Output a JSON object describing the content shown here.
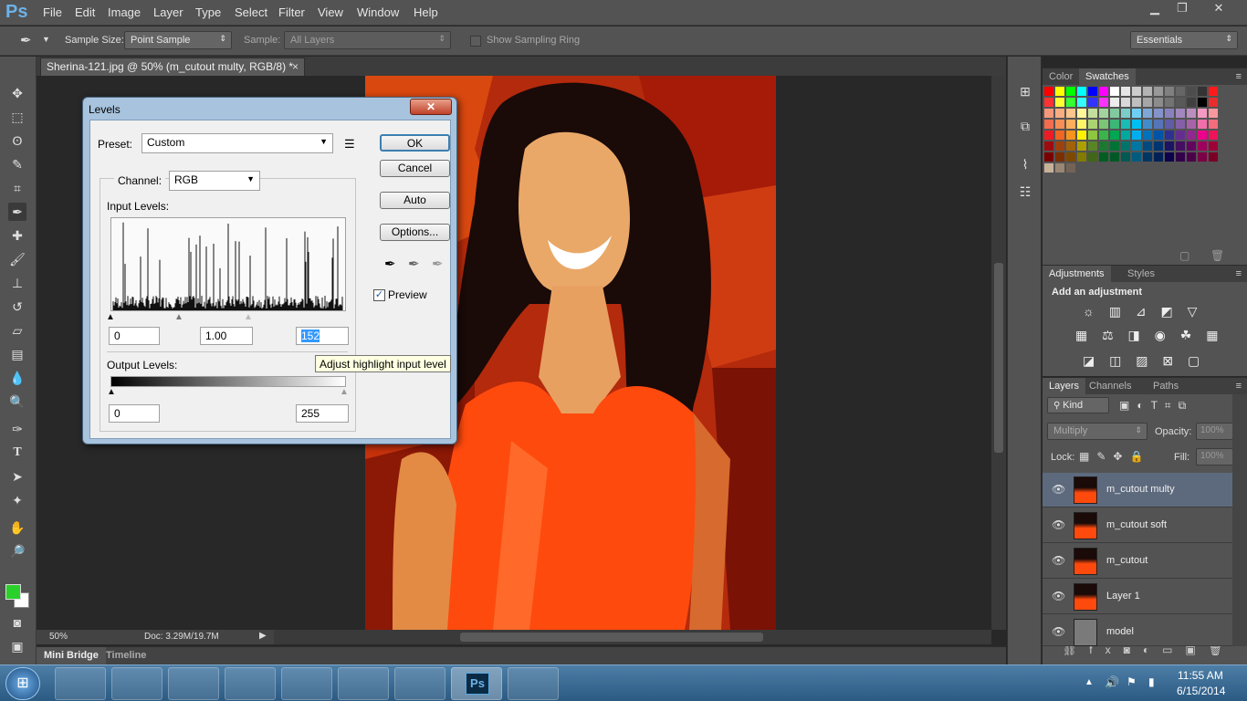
{
  "app": {
    "logo": "Ps",
    "menu": [
      "File",
      "Edit",
      "Image",
      "Layer",
      "Type",
      "Select",
      "Filter",
      "View",
      "Window",
      "Help"
    ]
  },
  "options_bar": {
    "sample_size_label": "Sample Size:",
    "sample_size_value": "Point Sample",
    "sample_label": "Sample:",
    "sample_value": "All Layers",
    "show_ring_label": "Show Sampling Ring",
    "workspace": "Essentials"
  },
  "document_tab": {
    "title": "Sherina-121.jpg @ 50% (m_cutout multy, RGB/8) *",
    "close": "×"
  },
  "status": {
    "zoom": "50%",
    "doc": "Doc: 3.29M/19.7M"
  },
  "bottom_tabs": [
    "Mini Bridge",
    "Timeline"
  ],
  "levels_dialog": {
    "title": "Levels",
    "preset_label": "Preset:",
    "preset_value": "Custom",
    "channel_label": "Channel:",
    "channel_value": "RGB",
    "input_levels_label": "Input Levels:",
    "input_black": "0",
    "input_gamma": "1.00",
    "input_white": "152",
    "output_levels_label": "Output Levels:",
    "output_black": "0",
    "output_white": "255",
    "buttons": [
      "OK",
      "Cancel",
      "Auto",
      "Options..."
    ],
    "preview_label": "Preview",
    "preview_checked": true,
    "tooltip": "Adjust highlight input level"
  },
  "swatch_panel": {
    "tabs": [
      "Color",
      "Swatches"
    ],
    "active_tab": "Swatches"
  },
  "adjustments_panel": {
    "tabs": [
      "Adjustments",
      "Styles"
    ],
    "heading": "Add an adjustment"
  },
  "layers_panel": {
    "tabs": [
      "Layers",
      "Channels",
      "Paths"
    ],
    "filter_label": "Kind",
    "blend_mode": "Multiply",
    "opacity_label": "Opacity:",
    "opacity_value": "100%",
    "lock_label": "Lock:",
    "fill_label": "Fill:",
    "fill_value": "100%",
    "layers": [
      {
        "name": "m_cutout multy",
        "selected": true
      },
      {
        "name": "m_cutout soft",
        "selected": false
      },
      {
        "name": "m_cutout",
        "selected": false
      },
      {
        "name": "Layer 1",
        "selected": false
      },
      {
        "name": "model",
        "selected": false
      }
    ]
  },
  "taskbar": {
    "time": "11:55 AM",
    "date": "6/15/2014"
  },
  "colors": {
    "foreground": "#2ad12a",
    "background": "#ffffff",
    "accent": "#2a5a83"
  }
}
